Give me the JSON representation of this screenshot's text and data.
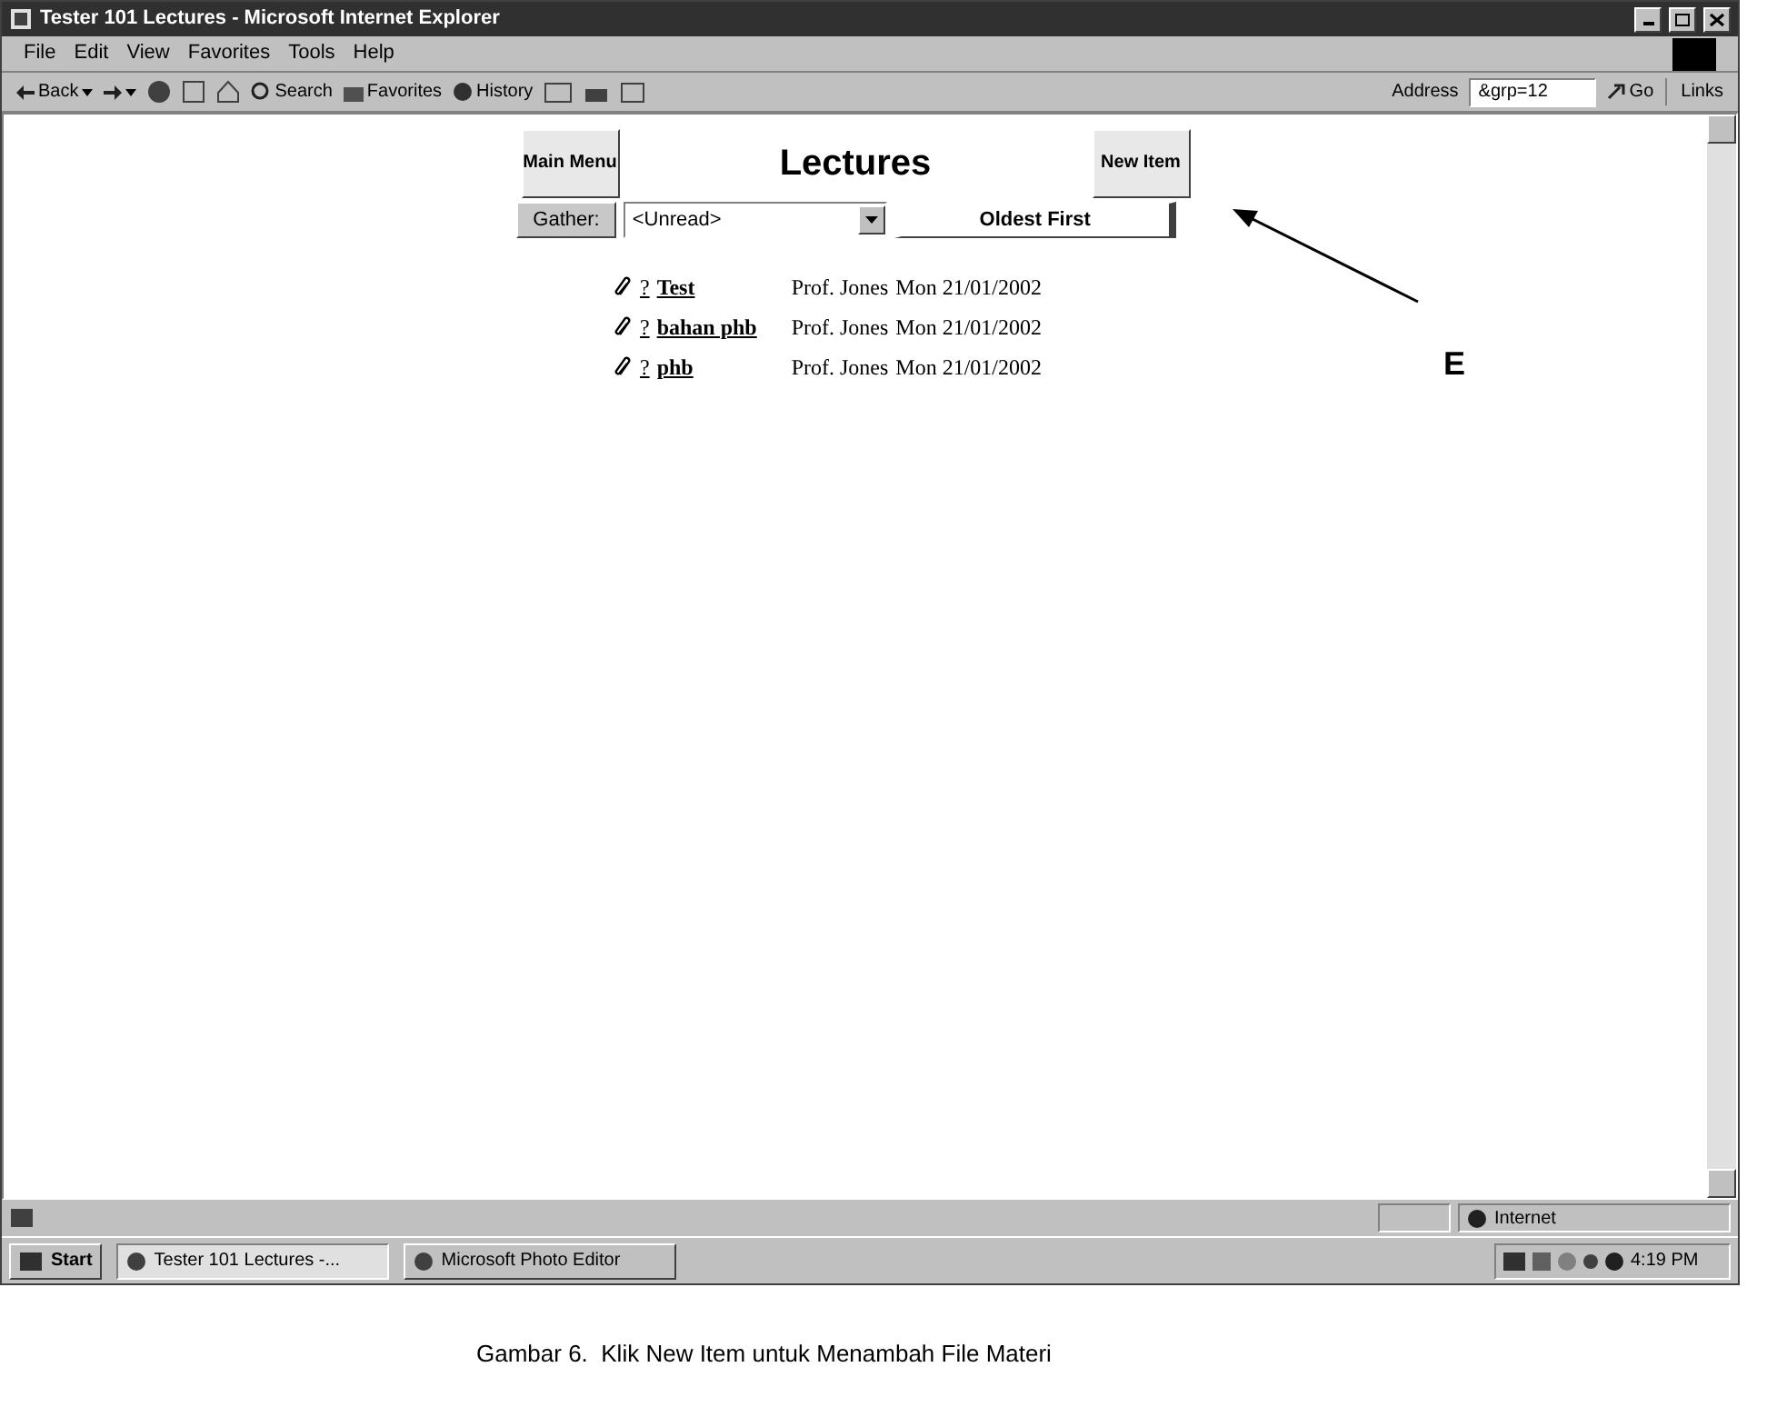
{
  "window": {
    "title": "Tester 101 Lectures - Microsoft Internet Explorer"
  },
  "menu": [
    "File",
    "Edit",
    "View",
    "Favorites",
    "Tools",
    "Help"
  ],
  "toolbar": {
    "back": "Back",
    "search": "Search",
    "favorites": "Favorites",
    "history": "History",
    "address_label": "Address",
    "address": "&grp=12",
    "go": "Go",
    "links": "Links"
  },
  "page": {
    "heading": "Lectures",
    "main_menu": "Main Menu",
    "new_item": "New Item",
    "gather": "Gather:",
    "filter": "<Unread>",
    "sort": "Oldest First",
    "items": [
      {
        "mark": "?",
        "title": "Test",
        "author": "Prof. Jones",
        "date": "Mon 21/01/2002"
      },
      {
        "mark": "?",
        "title": "bahan phb",
        "author": "Prof. Jones",
        "date": "Mon 21/01/2002"
      },
      {
        "mark": "?",
        "title": "phb",
        "author": "Prof. Jones",
        "date": "Mon 21/01/2002"
      }
    ]
  },
  "annotation": {
    "label": "E"
  },
  "status_bar": {
    "zone": "Internet"
  },
  "taskbar": {
    "start": "Start",
    "tasks": [
      {
        "label": "Tester 101 Lectures -...",
        "selected": true
      },
      {
        "label": "Microsoft Photo Editor",
        "selected": false
      }
    ],
    "clock": "4:19 PM"
  },
  "caption": "Gambar 6.  Klik New Item untuk Menambah File Materi"
}
